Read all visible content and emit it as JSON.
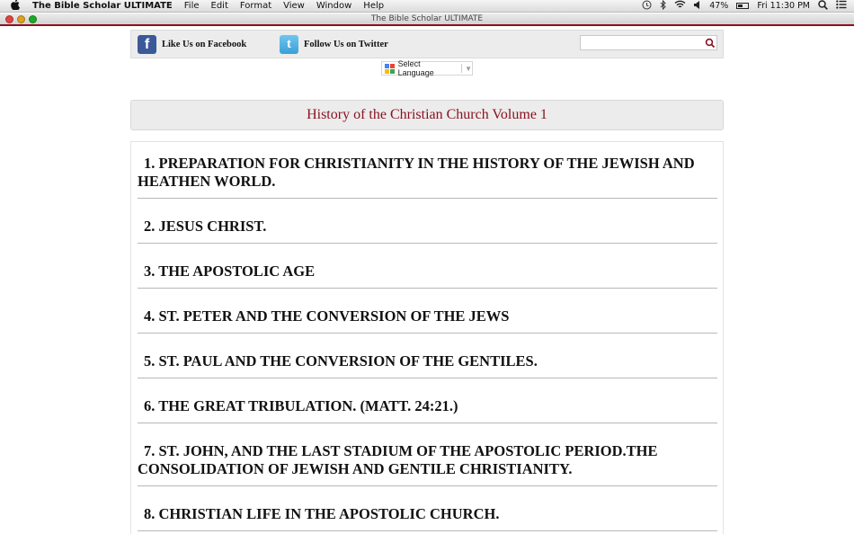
{
  "menubar": {
    "app_name": "The Bible Scholar ULTIMATE",
    "menus": [
      "File",
      "Edit",
      "Format",
      "View",
      "Window",
      "Help"
    ],
    "battery": "47%",
    "clock": "Fri 11:30 PM"
  },
  "window": {
    "title": "The Bible Scholar ULTIMATE"
  },
  "social": {
    "facebook_label": "Like Us on Facebook",
    "facebook_glyph": "f",
    "twitter_label": "Follow Us on Twitter",
    "twitter_glyph": "t",
    "search_value": ""
  },
  "translate": {
    "label": "Select Language"
  },
  "page": {
    "title": "History of the Christian Church Volume 1"
  },
  "chapters": [
    "1.  PREPARATION FOR CHRISTIANITY IN THE HISTORY OF THE JEWISH AND HEATHEN WORLD.",
    "2.  JESUS CHRIST.",
    "3.  THE APOSTOLIC AGE",
    "4.  ST. PETER AND THE CONVERSION OF THE JEWS",
    "5.  ST. PAUL AND THE CONVERSION OF THE GENTILES.",
    "6.  THE GREAT TRIBULATION. (MATT. 24:21.)",
    "7.  ST. JOHN, AND THE LAST STADIUM OF THE APOSTOLIC PERIOD.THE CONSOLIDATION OF JEWISH AND GENTILE CHRISTIANITY.",
    "8.  CHRISTIAN LIFE IN THE APOSTOLIC CHURCH."
  ],
  "colors": {
    "accent": "#8a1220",
    "facebook": "#3b5998",
    "twitter": "#3aa0d6"
  }
}
